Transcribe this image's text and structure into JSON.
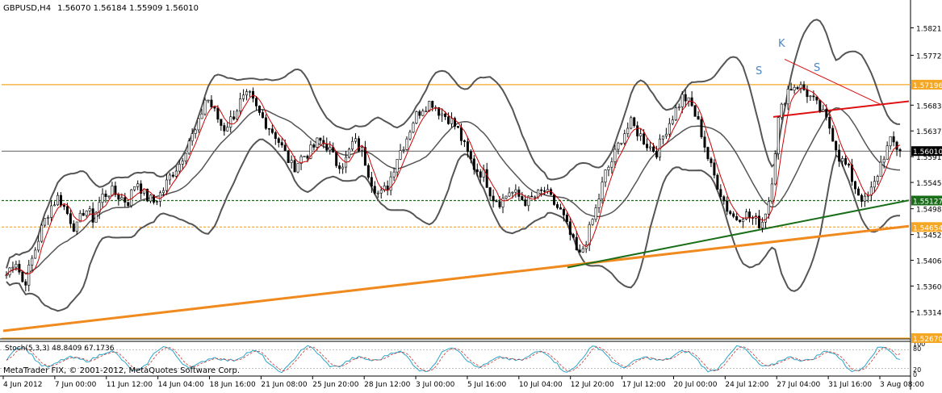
{
  "header": {
    "symbol_tf": "GBPUSD,H4",
    "ohlc": "1.56070 1.56184 1.55909 1.56010"
  },
  "footer": {
    "copyright": "MetaTrader FIX, © 2001-2012, MetaQuotes Software Corp."
  },
  "colors": {
    "price_bars": "#000000",
    "bollinger": "#555555",
    "ma": "#cc0000",
    "orange_lines": "#f5a623",
    "orange_trend": "#f08a1e",
    "green_trend": "#1a6e1a",
    "red_trend": "#dd1111",
    "stoch_main": "#2aa6c8",
    "stoch_signal": "#cc3333",
    "label_blue": "#4a86c8"
  },
  "chart_data": {
    "type": "candlestick",
    "symbol": "GBPUSD",
    "timeframe": "H4",
    "ylim": [
      1.5267,
      1.5865
    ],
    "y_ticks": [
      "1.58210",
      "1.57720",
      "1.56830",
      "1.56370",
      "1.55910",
      "1.55450",
      "1.54980",
      "1.54520",
      "1.54060",
      "1.53600",
      "1.53140"
    ],
    "x_ticks": [
      "4 Jun 2012",
      "7 Jun 00:00",
      "11 Jun 12:00",
      "14 Jun 04:00",
      "18 Jun 16:00",
      "21 Jun 08:00",
      "25 Jun 20:00",
      "28 Jun 12:00",
      "3 Jul 00:00",
      "5 Jul 16:00",
      "10 Jul 04:00",
      "12 Jul 20:00",
      "17 Jul 12:00",
      "20 Jul 00:00",
      "24 Jul 12:00",
      "27 Jul 04:00",
      "31 Jul 16:00",
      "3 Aug 08:00"
    ],
    "price_path": [
      1.538,
      1.541,
      1.536,
      1.541,
      1.546,
      1.55,
      1.552,
      1.549,
      1.546,
      1.55,
      1.548,
      1.552,
      1.553,
      1.552,
      1.551,
      1.555,
      1.552,
      1.551,
      1.553,
      1.556,
      1.558,
      1.562,
      1.564,
      1.57,
      1.567,
      1.564,
      1.566,
      1.569,
      1.57,
      1.567,
      1.565,
      1.563,
      1.56,
      1.557,
      1.559,
      1.56,
      1.562,
      1.561,
      1.558,
      1.558,
      1.562,
      1.56,
      1.555,
      1.552,
      1.554,
      1.559,
      1.562,
      1.566,
      1.568,
      1.569,
      1.567,
      1.566,
      1.564,
      1.56,
      1.557,
      1.556,
      1.552,
      1.551,
      1.553,
      1.552,
      1.551,
      1.552,
      1.553,
      1.551,
      1.549,
      1.545,
      1.541,
      1.545,
      1.55,
      1.556,
      1.559,
      1.563,
      1.565,
      1.563,
      1.561,
      1.56,
      1.564,
      1.567,
      1.57,
      1.568,
      1.564,
      1.558,
      1.554,
      1.55,
      1.548,
      1.549,
      1.548,
      1.547,
      1.552,
      1.566,
      1.571,
      1.572,
      1.571,
      1.569,
      1.567,
      1.564,
      1.559,
      1.557,
      1.553,
      1.551,
      1.554,
      1.559,
      1.562,
      1.56
    ],
    "horizontal_levels": [
      {
        "label": "1.57196",
        "value": 1.57196,
        "color": "#f5a623"
      },
      {
        "label": "1.56010",
        "value": 1.5601,
        "color": "#000000"
      },
      {
        "label": "1.55127",
        "value": 1.55127,
        "color": "#1a6e1a"
      },
      {
        "label": "1.54654",
        "value": 1.54654,
        "color": "#f5a623"
      },
      {
        "label": "1.52670",
        "value": 1.5267,
        "color": "#f5a623"
      }
    ],
    "annotations": [
      "S",
      "K",
      "S"
    ],
    "stochastic": {
      "label": "Stoch(5,3,3) 48.8409 67.1736",
      "main": 48.8409,
      "signal": 67.1736,
      "levels": [
        "100",
        "80",
        "20",
        "0"
      ]
    }
  }
}
